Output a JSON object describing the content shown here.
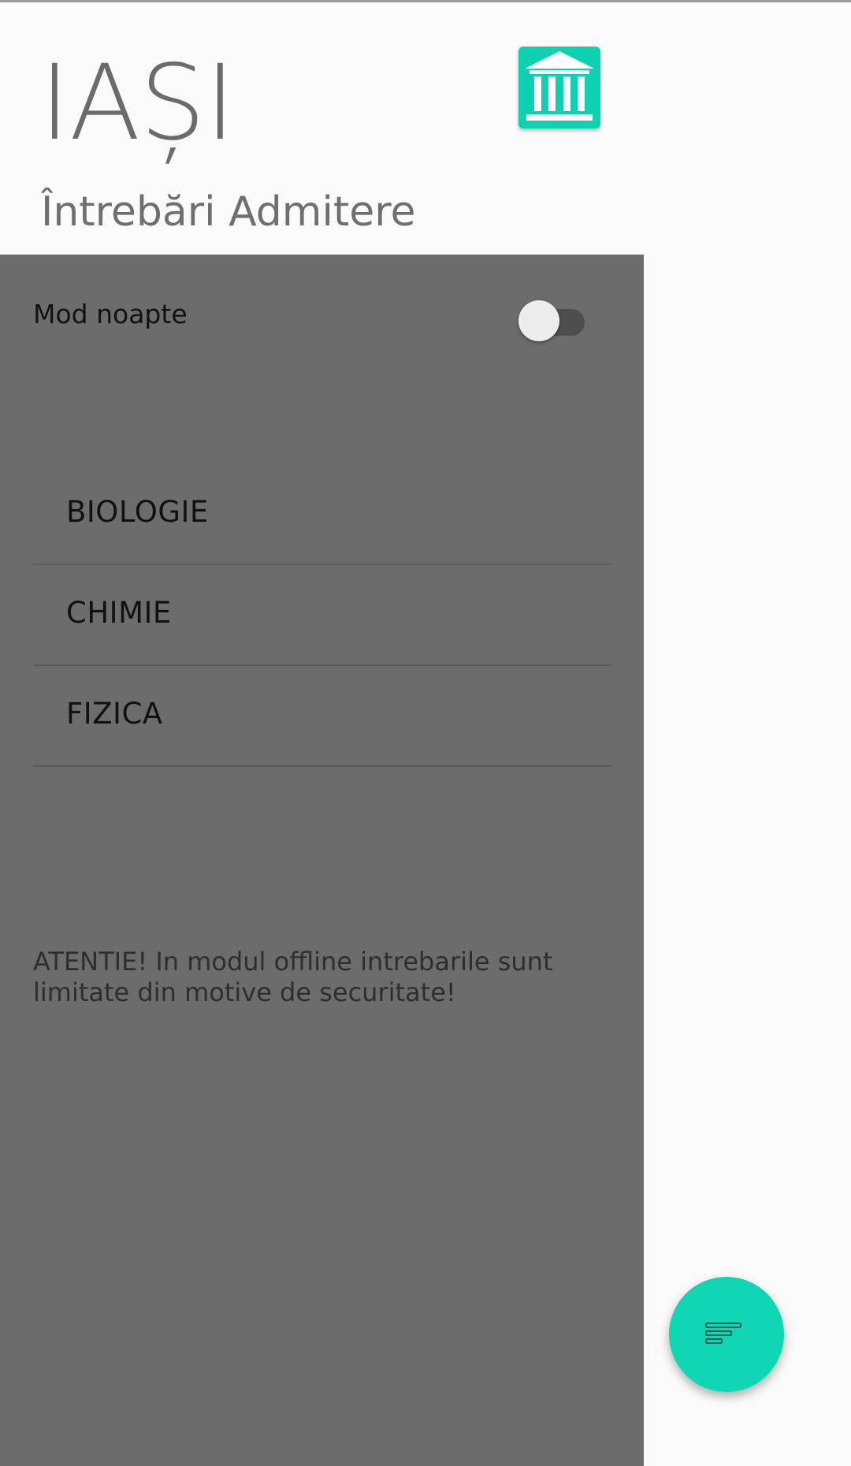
{
  "header": {
    "city": "IAȘI",
    "subtitle": "Întrebări Admitere",
    "logo_icon": "university-building-icon"
  },
  "drawer": {
    "night_mode_label": "Mod noapte",
    "night_mode_enabled": false,
    "subjects": [
      {
        "label": "BIOLOGIE"
      },
      {
        "label": "CHIMIE"
      },
      {
        "label": "FIZICA"
      }
    ],
    "warning": "ATENTIE! In modul offline intrebarile sunt limitate din motive de securitate!"
  },
  "fab": {
    "icon": "sort-icon"
  },
  "colors": {
    "accent": "#0fd6b3",
    "drawer_background": "#6c6c6c",
    "header_background": "#fafafa"
  }
}
